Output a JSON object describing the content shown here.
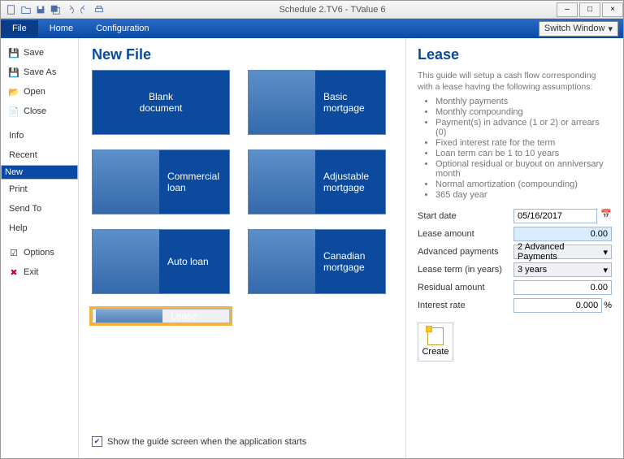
{
  "window": {
    "title": "Schedule 2.TV6 - TValue 6"
  },
  "ribbon": {
    "file": "File",
    "home": "Home",
    "config": "Configuration",
    "switch": "Switch Window"
  },
  "sidebar": {
    "save": "Save",
    "saveas": "Save As",
    "open": "Open",
    "close": "Close",
    "info": "Info",
    "recent": "Recent",
    "new": "New",
    "print": "Print",
    "sendto": "Send To",
    "help": "Help",
    "options": "Options",
    "exit": "Exit"
  },
  "center": {
    "title": "New File",
    "tiles": {
      "blank": "Blank document",
      "basic": "Basic mortgage",
      "commercial": "Commercial loan",
      "adjustable": "Adjustable mortgage",
      "auto": "Auto loan",
      "canadian": "Canadian mortgage",
      "lease": "Lease"
    },
    "footer_chk": "Show the guide screen when the application starts"
  },
  "right": {
    "title": "Lease",
    "desc": "This guide will setup a cash flow corresponding with a lease having the following assumptions:",
    "bullets": [
      "Monthly payments",
      "Monthly compounding",
      "Payment(s) in advance (1 or 2) or arrears (0)",
      "Fixed interest rate for the term",
      "Loan term can be 1 to 10 years",
      "Optional residual or buyout on anniversary month",
      "Normal amortization (compounding)",
      "365 day year"
    ],
    "form": {
      "start_label": "Start date",
      "start_val": "05/16/2017",
      "amount_label": "Lease amount",
      "amount_val": "0.00",
      "adv_label": "Advanced payments",
      "adv_val": "2 Advanced Payments",
      "term_label": "Lease term (in years)",
      "term_val": "3 years",
      "resid_label": "Residual amount",
      "resid_val": "0.00",
      "rate_label": "Interest rate",
      "rate_val": "0.000",
      "rate_suffix": "%"
    },
    "create": "Create"
  }
}
